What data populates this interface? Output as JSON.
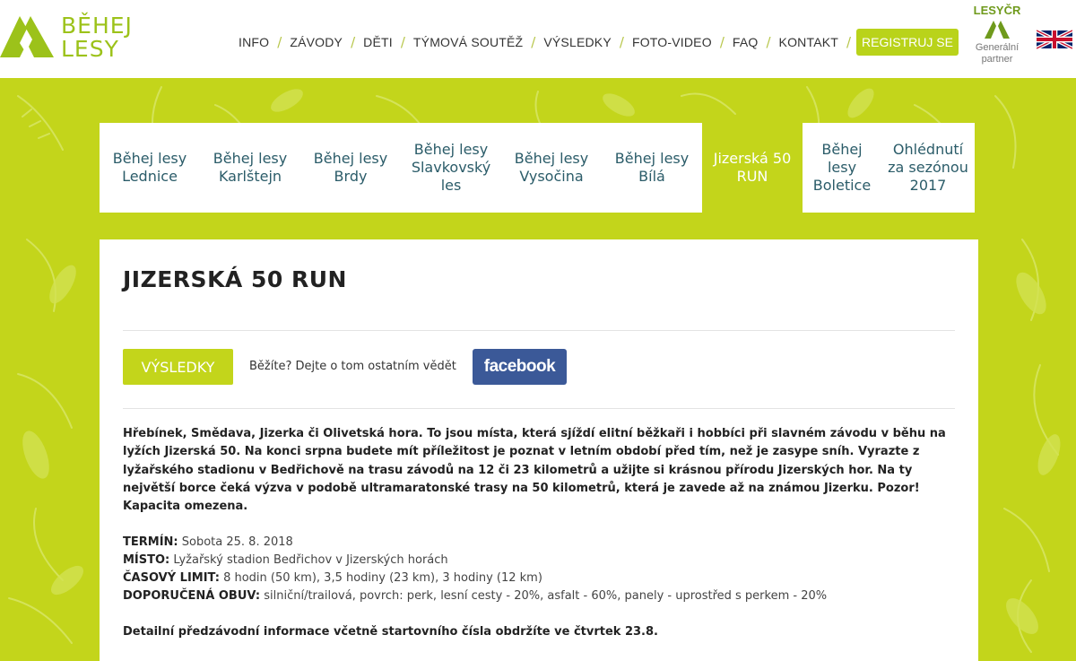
{
  "brand": {
    "line1": "BĚHEJ",
    "line2": "LESY",
    "color": "#9cc21a"
  },
  "nav": {
    "items": [
      "INFO",
      "ZÁVODY",
      "DĚTI",
      "TÝMOVÁ SOUTĚŽ",
      "VÝSLEDKY",
      "FOTO-VIDEO",
      "FAQ",
      "KONTAKT"
    ],
    "register": "REGISTRUJ SE"
  },
  "partner": {
    "name": "LESYČR",
    "sub1": "Generální",
    "sub2": "partner"
  },
  "language_flag": "uk-flag-icon",
  "tabs": [
    "Běhej lesy Lednice",
    "Běhej lesy Karlštejn",
    "Běhej lesy Brdy",
    "Běhej lesy Slavkovský les",
    "Běhej lesy Vysočina",
    "Běhej lesy Bílá",
    "Jizerská 50 RUN",
    "Běhej lesy Boletice",
    "Ohlédnutí za sezónou 2017"
  ],
  "active_tab": "Jizerská 50 RUN",
  "page": {
    "title": "JIZERSKÁ 50 RUN",
    "results_button": "VÝSLEDKY",
    "share_text": "Běžíte? Dejte o tom ostatním vědět",
    "facebook_button": "facebook",
    "intro": "Hřebínek, Smědava, Jizerka či Olivetská hora. To jsou místa, která sjíždí elitní běžkaři i hobbíci při slavném závodu v běhu na lyžích Jizerská 50. Na konci srpna budete mít příležitost je poznat v letním období před tím, než je zasype sníh. Vyrazte z lyžařského stadionu v Bedřichově na trasu závodů na 12 či 23 kilometrů a užijte si krásnou přírodu Jizerských hor. Na ty největší borce čeká výzva v podobě ultramaratonské trasy na 50 kilometrů, která je zavede až na známou Jizerku. Pozor! Kapacita omezena.",
    "details": [
      {
        "label": "TERMÍN:",
        "value": "Sobota 25. 8. 2018"
      },
      {
        "label": "MÍSTO:",
        "value": "Lyžařský stadion Bedřichov v Jizerských horách"
      },
      {
        "label": "ČASOVÝ LIMIT:",
        "value": "8 hodin (50 km), 3,5 hodiny (23 km), 3 hodiny (12 km)"
      },
      {
        "label": "DOPORUČENÁ OBUV:",
        "value": "silniční/trailová, povrch: perk, lesní cesty - 20%, asfalt - 60%, panely - uprostřed s perkem - 20%"
      }
    ],
    "notice": "Detailní předzávodní informace včetně startovního čísla obdržíte ve čtvrtek 23.8."
  },
  "colors": {
    "accent": "#c3d51b",
    "tab_text": "#2b5c69",
    "facebook": "#3b5998"
  }
}
